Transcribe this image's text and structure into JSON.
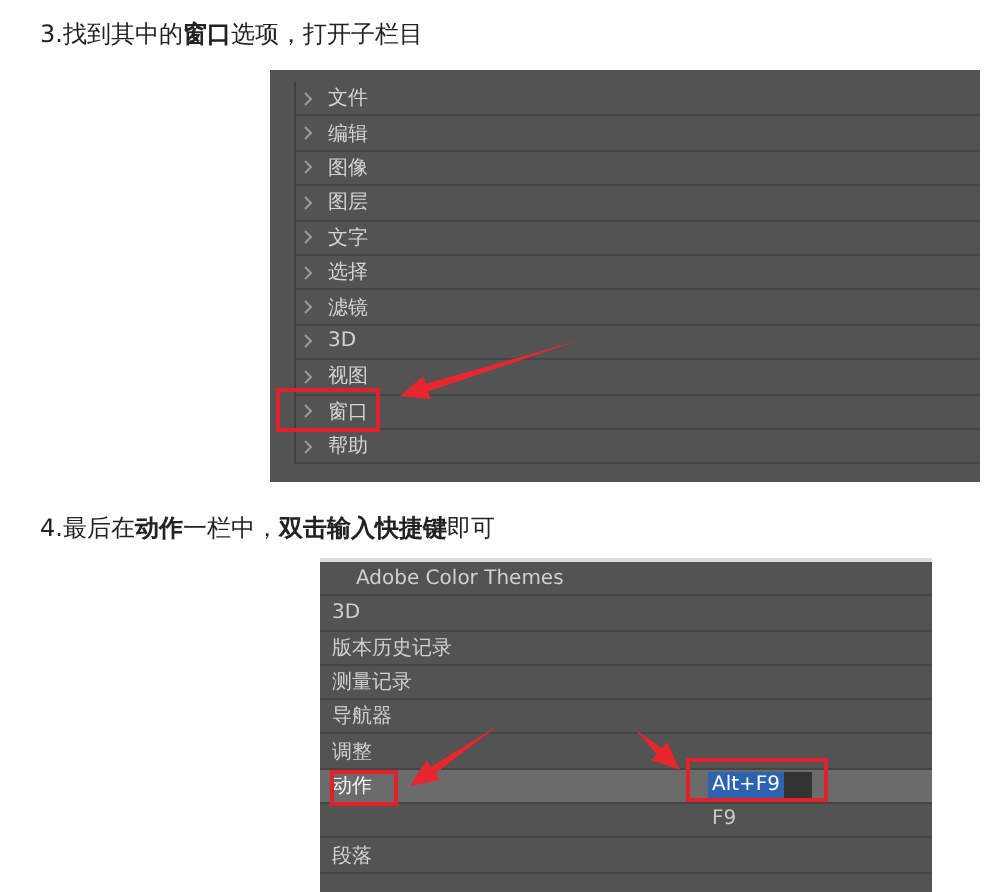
{
  "steps": [
    {
      "text": "3.找到其中的**窗口**选项，打开子栏目",
      "menu": {
        "kind": "menu-bar",
        "items": [
          {
            "label": "文件",
            "annotated": false
          },
          {
            "label": "编辑",
            "annotated": false
          },
          {
            "label": "图像",
            "annotated": false
          },
          {
            "label": "图层",
            "annotated": false
          },
          {
            "label": "文字",
            "annotated": false
          },
          {
            "label": "选择",
            "annotated": false
          },
          {
            "label": "滤镜",
            "annotated": false
          },
          {
            "label": "3D",
            "annotated": false
          },
          {
            "label": "视图",
            "annotated": false
          },
          {
            "label": "窗口",
            "annotated": true
          },
          {
            "label": "帮助",
            "annotated": false
          }
        ]
      }
    },
    {
      "text": "4.最后在**动作**一栏中，**双击输入快捷键**即可",
      "menu": {
        "kind": "shortcut-list",
        "items": [
          {
            "kind": "header",
            "label": "Adobe Color Themes",
            "selected": false,
            "annotated": false
          },
          {
            "kind": "item",
            "label": "3D",
            "selected": false,
            "annotated": false
          },
          {
            "kind": "item",
            "label": "版本历史记录",
            "selected": false,
            "annotated": false
          },
          {
            "kind": "item",
            "label": "测量记录",
            "selected": false,
            "annotated": false
          },
          {
            "kind": "item",
            "label": "导航器",
            "selected": false,
            "annotated": false
          },
          {
            "kind": "item",
            "label": "调整",
            "selected": false,
            "annotated": false
          },
          {
            "kind": "item",
            "label": "动作",
            "selected": true,
            "annotated": true,
            "shortcut": {
              "text": "Alt+F9",
              "editing": true,
              "annotated": true
            }
          },
          {
            "kind": "item",
            "selected": false,
            "annotated": false,
            "shortcut": {
              "text": "F9",
              "editing": false,
              "annotated": false
            }
          },
          {
            "kind": "item",
            "label": "段落",
            "selected": false,
            "annotated": false
          }
        ]
      }
    }
  ]
}
